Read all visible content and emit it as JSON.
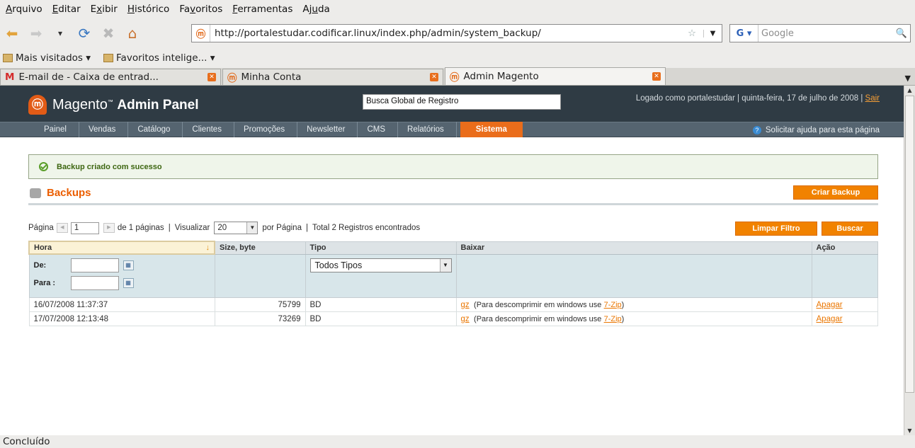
{
  "browser": {
    "menu": [
      {
        "label": "Arquivo",
        "accel": "A"
      },
      {
        "label": "Editar",
        "accel": "E"
      },
      {
        "label": "Exibir",
        "accel": "x"
      },
      {
        "label": "Histórico",
        "accel": "H"
      },
      {
        "label": "Favoritos",
        "accel": "v"
      },
      {
        "label": "Ferramentas",
        "accel": "F"
      },
      {
        "label": "Ajuda",
        "accel": "u"
      }
    ],
    "url": "http://portalestudar.codificar.linux/index.php/admin/system_backup/",
    "search_placeholder": "Google",
    "bookmarks": [
      "Mais visitados ▾",
      "Favoritos intelige... ▾"
    ],
    "tabs": [
      {
        "label": "E-mail de  - Caixa de entrad...",
        "active": false
      },
      {
        "label": "Minha Conta",
        "active": false
      },
      {
        "label": "Admin Magento",
        "active": true
      }
    ],
    "status": "Concluído"
  },
  "magento": {
    "logo_text": "Magento",
    "logo_sub": "Admin Panel",
    "global_search": "Busca Global de Registro",
    "login_info": "Logado como portalestudar | quinta-feira, 17 de julho de 2008 |",
    "logout": "Sair",
    "nav": [
      "Painel",
      "Vendas",
      "Catálogo",
      "Clientes",
      "Promoções",
      "Newsletter",
      "CMS",
      "Relatórios",
      "Sistema"
    ],
    "active_nav": "Sistema",
    "help": "Solicitar ajuda para esta página"
  },
  "content": {
    "success_message": "Backup criado com sucesso",
    "title": "Backups",
    "create_button": "Criar Backup",
    "reset_button": "Limpar Filtro",
    "search_button": "Buscar",
    "pager": {
      "page_label": "Página",
      "page_value": "1",
      "of_pages": "de 1 páginas",
      "view_label": "Visualizar",
      "per_page": "20",
      "per_page_label": "por Página",
      "total": "Total 2 Registros encontrados"
    },
    "columns": [
      "Hora",
      "Size, byte",
      "Tipo",
      "Baixar",
      "Ação"
    ],
    "filter": {
      "from_label": "De:",
      "to_label": "Para :",
      "type_value": "Todos Tipos"
    },
    "rows": [
      {
        "time": "16/07/2008 11:37:37",
        "size": "75799",
        "type": "BD",
        "link": "gz",
        "hint": "(Para descomprimir em windows use",
        "zip": "7-Zip",
        "close": ")",
        "action": "Apagar"
      },
      {
        "time": "17/07/2008 12:13:48",
        "size": "73269",
        "type": "BD",
        "link": "gz",
        "hint": "(Para descomprimir em windows use",
        "zip": "7-Zip",
        "close": ")",
        "action": "Apagar"
      }
    ]
  }
}
